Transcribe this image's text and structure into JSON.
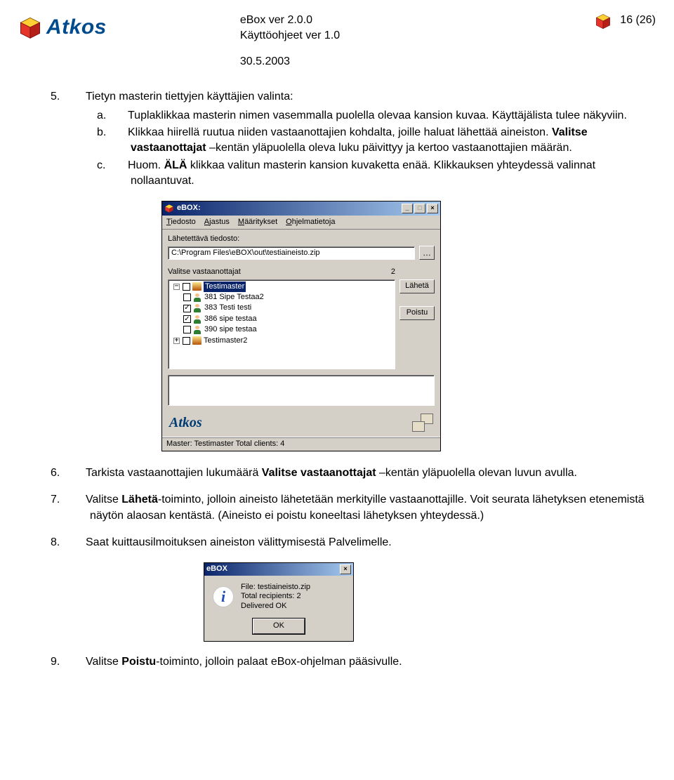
{
  "brand": "Atkos",
  "header": {
    "line1": "eBox ver 2.0.0",
    "line2": "Käyttöohjeet ver 1.0",
    "date": "30.5.2003",
    "page": "16 (26)"
  },
  "list5": {
    "num": "5.",
    "text": "Tietyn masterin tiettyjen käyttäjien valinta:",
    "a": {
      "let": "a.",
      "text": "Tuplaklikkaa masterin nimen vasemmalla puolella olevaa kansion kuvaa. Käyttäjälista tulee näkyviin."
    },
    "b": {
      "let": "b.",
      "pre": "Klikkaa hiirellä ruutua niiden vastaanottajien kohdalta, joille haluat lähettää aineiston. ",
      "bold": "Valitse vastaanottajat",
      "post": " –kentän yläpuolella oleva luku päivittyy ja kertoo vastaanottajien määrän."
    },
    "c": {
      "let": "c.",
      "pre": "Huom. ",
      "bold": "ÄLÄ",
      "post": " klikkaa valitun masterin kansion kuvaketta enää. Klikkauksen yhteydessä valinnat nollaantuvat."
    }
  },
  "list6": {
    "num": "6.",
    "pre": "Tarkista vastaanottajien lukumäärä ",
    "bold": "Valitse vastaanottajat",
    "post": " –kentän yläpuolella olevan luvun avulla."
  },
  "list7": {
    "num": "7.",
    "pre": "Valitse ",
    "bold": "Lähetä",
    "post": "-toiminto, jolloin aineisto lähetetään merkityille vastaanottajille. Voit seurata lähetyksen etenemistä näytön alaosan kentästä. (Aineisto ei poistu koneeltasi lähetyksen yhteydessä.)"
  },
  "list8": {
    "num": "8.",
    "text": "Saat kuittausilmoituksen aineiston välittymisestä Palvelimelle."
  },
  "list9": {
    "num": "9.",
    "pre": "Valitse ",
    "bold": "Poistu",
    "post": "-toiminto, jolloin palaat eBox-ohjelman pääsivulle."
  },
  "win": {
    "title": "eBOX:",
    "menu": {
      "file": "Tiedosto",
      "ajastus": "Ajastus",
      "maaritykset": "Määritykset",
      "ohje": "Ohjelmatietoja"
    },
    "file_label": "Lähetettävä tiedosto:",
    "file_value": "C:\\Program Files\\eBOX\\out\\testiaineisto.zip",
    "recipients_label": "Valitse vastaanottajat",
    "recipients_count": "2",
    "send_btn": "Lähetä",
    "exit_btn": "Poistu",
    "status": "Master: Testimaster   Total clients: 4",
    "brand": "Atkos",
    "tree": {
      "m1": "Testimaster",
      "i1": {
        "id": "381",
        "name": "Sipe Testaa2",
        "checked": false
      },
      "i2": {
        "id": "383",
        "name": "Testi testi",
        "checked": true
      },
      "i3": {
        "id": "386",
        "name": "sipe testaa",
        "checked": true
      },
      "i4": {
        "id": "390",
        "name": "sipe testaa",
        "checked": false
      },
      "m2": "Testimaster2"
    }
  },
  "dialog": {
    "title": "eBOX",
    "l1": "File: testiaineisto.zip",
    "l2": "Total recipients: 2",
    "l3": "Delivered OK",
    "ok": "OK"
  }
}
